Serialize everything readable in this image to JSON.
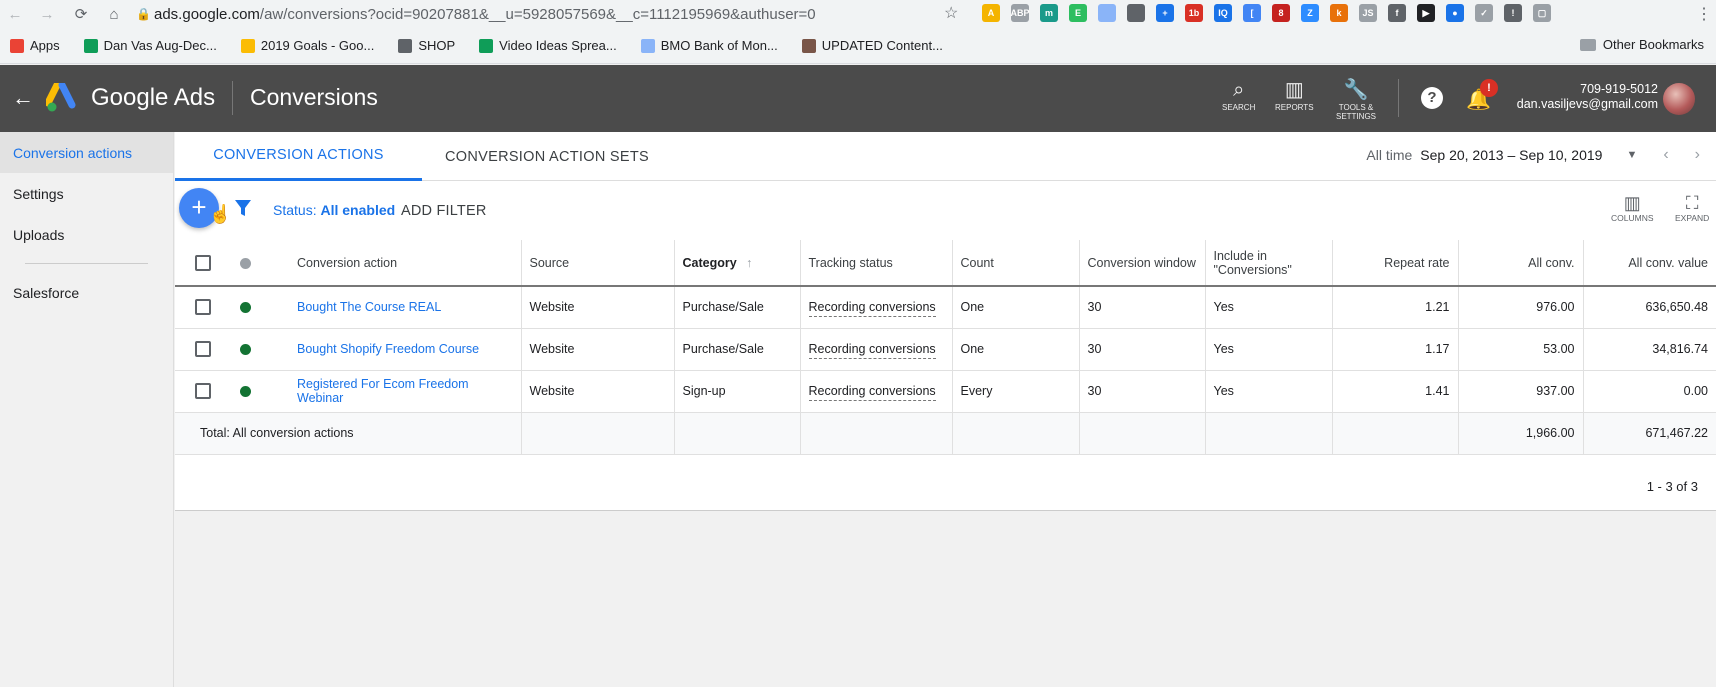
{
  "browser": {
    "url_host": "ads.google.com",
    "url_path": "/aw/conversions?ocid=90207881&__u=5928057569&__c=1112195969&authuser=0",
    "extensions": [
      {
        "name": "adsense-icon",
        "color": "#f4b400",
        "label": "A"
      },
      {
        "name": "abp-icon",
        "color": "#9aa0a6",
        "label": "ABP"
      },
      {
        "name": "circle-ext-icon",
        "color": "#1a9a8a",
        "label": "m"
      },
      {
        "name": "evernote-icon",
        "color": "#2dbe60",
        "label": "E"
      },
      {
        "name": "image-ext-icon",
        "color": "#8ab4f8",
        "label": ""
      },
      {
        "name": "pen-ext-icon",
        "color": "#5f6368",
        "label": ""
      },
      {
        "name": "crosshair-ext-icon",
        "color": "#1a73e8",
        "label": "+"
      },
      {
        "name": "lb-ext-icon",
        "color": "#d93025",
        "label": "1b"
      },
      {
        "name": "iq-ext-icon",
        "color": "#1a73e8",
        "label": "IQ"
      },
      {
        "name": "bracket-ext-icon",
        "color": "#4285f4",
        "label": "["
      },
      {
        "name": "calendar-ext-icon",
        "color": "#c5221f",
        "label": "8"
      },
      {
        "name": "zoom-ext-icon",
        "color": "#2d8cff",
        "label": "Z"
      },
      {
        "name": "k-ext-icon",
        "color": "#e8710a",
        "label": "k"
      },
      {
        "name": "js-ext-icon",
        "color": "#9aa0a6",
        "label": "JS"
      },
      {
        "name": "facebook-ext-icon",
        "color": "#5f6368",
        "label": "f"
      },
      {
        "name": "play-ext-icon",
        "color": "#202124",
        "label": "▶"
      },
      {
        "name": "badge-ext-icon",
        "color": "#1a73e8",
        "label": "●"
      },
      {
        "name": "feather-ext-icon",
        "color": "#9aa0a6",
        "label": "✓"
      },
      {
        "name": "bulb-ext-icon",
        "color": "#5f6368",
        "label": "!"
      },
      {
        "name": "screen-ext-icon",
        "color": "#9aa0a6",
        "label": "▢"
      }
    ]
  },
  "bookmarks": {
    "items": [
      {
        "label": "Apps",
        "icon": "apps-grid-icon",
        "color": "#ea4335"
      },
      {
        "label": "Dan Vas Aug-Dec...",
        "icon": "sheets-icon",
        "color": "#0f9d58"
      },
      {
        "label": "2019 Goals - Goo...",
        "icon": "drive-icon",
        "color": "#fbbc04"
      },
      {
        "label": "SHOP",
        "icon": "globe-icon",
        "color": "#5f6368"
      },
      {
        "label": "Video Ideas Sprea...",
        "icon": "sheets-icon",
        "color": "#0f9d58"
      },
      {
        "label": "BMO Bank of Mon...",
        "icon": "bank-icon",
        "color": "#8ab4f8"
      },
      {
        "label": "UPDATED Content...",
        "icon": "film-icon",
        "color": "#795548"
      }
    ],
    "other": "Other Bookmarks"
  },
  "header": {
    "brand": "Google Ads",
    "title": "Conversions",
    "tools": [
      {
        "label": "SEARCH",
        "icon": "search-icon"
      },
      {
        "label": "REPORTS",
        "icon": "reports-icon"
      },
      {
        "label": "TOOLS &\nSETTINGS",
        "icon": "wrench-icon"
      }
    ],
    "notification_badge": "!",
    "account_phone": "709-919-5012",
    "account_email": "dan.vasiljevs@gmail.com"
  },
  "sidebar": {
    "items": [
      {
        "label": "Conversion actions",
        "active": true
      },
      {
        "label": "Settings",
        "active": false
      },
      {
        "label": "Uploads",
        "active": false
      },
      {
        "label": "Salesforce",
        "active": false
      }
    ]
  },
  "main": {
    "tabs": [
      {
        "label": "CONVERSION ACTIONS",
        "active": true
      },
      {
        "label": "CONVERSION ACTION SETS",
        "active": false
      }
    ],
    "date": {
      "label": "All time",
      "range": "Sep 20, 2013 – Sep 10, 2019"
    },
    "toolbar": {
      "status_prefix": "Status:",
      "status_value": "All enabled",
      "add_filter": "ADD FILTER",
      "columns": "COLUMNS",
      "expand": "EXPAND"
    },
    "table": {
      "headers": {
        "action": "Conversion action",
        "source": "Source",
        "category": "Category",
        "tracking": "Tracking status",
        "count": "Count",
        "window": "Conversion window",
        "include": "Include in \"Conversions\"",
        "repeat": "Repeat rate",
        "all_conv": "All conv.",
        "all_value": "All conv. value"
      },
      "rows": [
        {
          "action": "Bought The Course REAL",
          "source": "Website",
          "category": "Purchase/Sale",
          "tracking": "Recording conversions",
          "count": "One",
          "window": "30",
          "include": "Yes",
          "repeat": "1.21",
          "all_conv": "976.00",
          "all_value": "636,650.48"
        },
        {
          "action": "Bought Shopify Freedom Course",
          "source": "Website",
          "category": "Purchase/Sale",
          "tracking": "Recording conversions",
          "count": "One",
          "window": "30",
          "include": "Yes",
          "repeat": "1.17",
          "all_conv": "53.00",
          "all_value": "34,816.74"
        },
        {
          "action": "Registered For Ecom Freedom Webinar",
          "source": "Website",
          "category": "Sign-up",
          "tracking": "Recording conversions",
          "count": "Every",
          "window": "30",
          "include": "Yes",
          "repeat": "1.41",
          "all_conv": "937.00",
          "all_value": "0.00"
        }
      ],
      "total": {
        "label": "Total: All conversion actions",
        "all_conv": "1,966.00",
        "all_value": "671,467.22"
      }
    },
    "pagination": "1 - 3 of 3"
  },
  "colors": {
    "accent": "#1a73e8",
    "status_enabled": "#137333",
    "header_bg": "#4b4b4b"
  }
}
